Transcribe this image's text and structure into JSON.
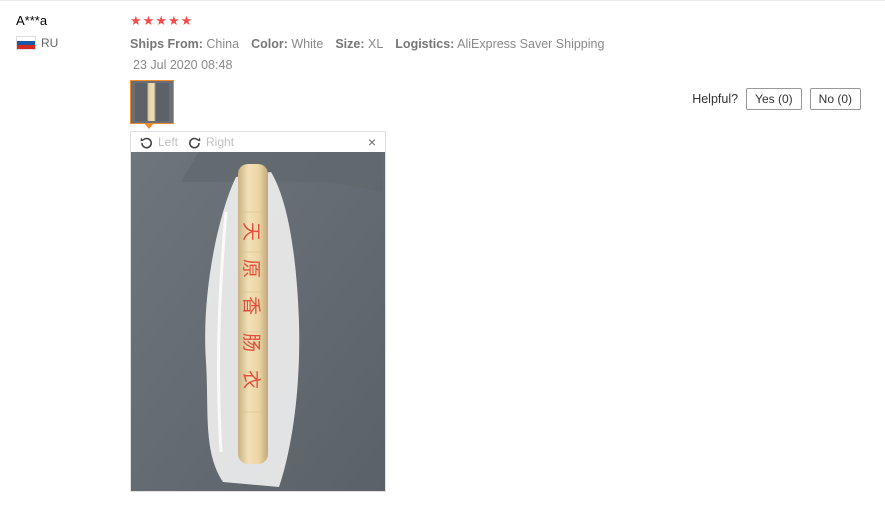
{
  "review": {
    "user": {
      "name": "A***a",
      "country": "RU",
      "flag_colors": [
        "#ffffff",
        "#1c57a7",
        "#d52b1e"
      ]
    },
    "rating": 5,
    "stars": [
      "★",
      "★",
      "★",
      "★",
      "★"
    ],
    "star_color": "#f24b4b",
    "attributes": [
      {
        "label": "Ships From:",
        "value": "China"
      },
      {
        "label": "Color:",
        "value": "White"
      },
      {
        "label": "Size:",
        "value": "XL"
      },
      {
        "label": "Logistics:",
        "value": "AliExpress Saver Shipping"
      }
    ],
    "date": "23 Jul 2020 08:48"
  },
  "helpful": {
    "label": "Helpful?",
    "yes": "Yes (0)",
    "no": "No (0)"
  },
  "viewer": {
    "rotate_left": "Left",
    "rotate_right": "Right",
    "close": "×",
    "photo_text": "天 原 香 肠 衣"
  },
  "accent_color": "#f28b2c"
}
